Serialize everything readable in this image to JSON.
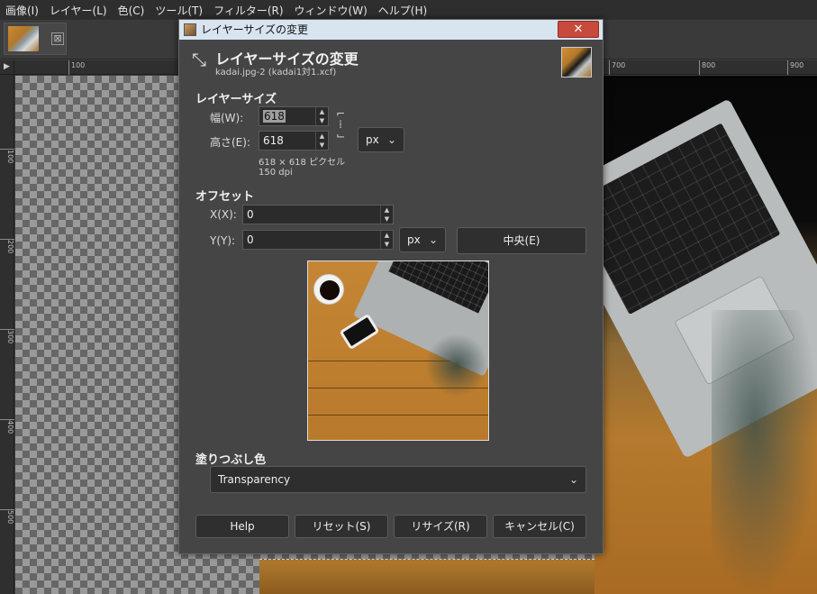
{
  "menubar": {
    "items": [
      "画像(I)",
      "レイヤー(L)",
      "色(C)",
      "ツール(T)",
      "フィルター(R)",
      "ウィンドウ(W)",
      "ヘルプ(H)"
    ]
  },
  "tabs": {
    "close_glyph": "⊠"
  },
  "ruler": {
    "corner": "▶",
    "h_ticks": [
      "100",
      "700",
      "800",
      "900"
    ],
    "v_ticks": [
      "100",
      "200",
      "300",
      "400",
      "500"
    ]
  },
  "dialog": {
    "window_title": "レイヤーサイズの変更",
    "close_glyph": "✕",
    "heading": "レイヤーサイズの変更",
    "subtitle": "kadai.jpg-2 (kadai1対1.xcf)",
    "layer_size_section": "レイヤーサイズ",
    "width_label": "幅(W):",
    "width_value": "618",
    "height_label": "高さ(E):",
    "height_value": "618",
    "size_unit": "px",
    "pixel_info": "618 × 618 ピクセル",
    "dpi_info": "150 dpi",
    "offset_section": "オフセット",
    "x_label": "X(X):",
    "x_value": "0",
    "y_label": "Y(Y):",
    "y_value": "0",
    "offset_unit": "px",
    "center_button": "中央(E)",
    "fill_section": "塗りつぶし色",
    "fill_value": "Transparency",
    "buttons": {
      "help": "Help",
      "reset": "リセット(S)",
      "resize": "リサイズ(R)",
      "cancel": "キャンセル(C)"
    }
  },
  "colors": {
    "titlebar": "#d9e4f1",
    "close": "#c74a3c",
    "dialog_bg": "#454545"
  }
}
